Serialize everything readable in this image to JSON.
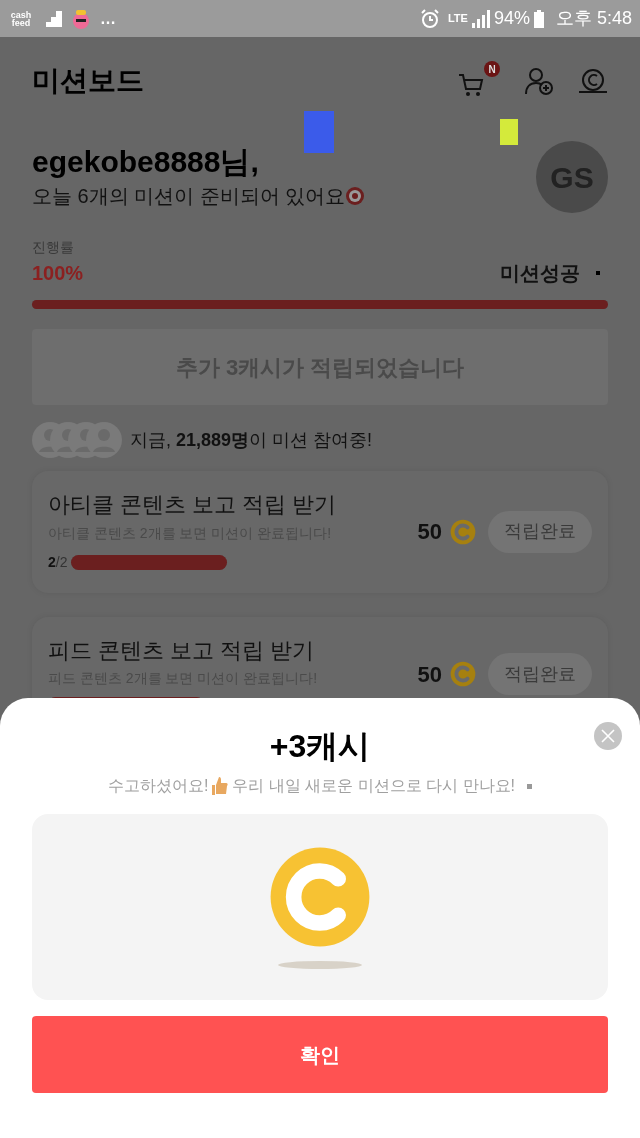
{
  "status_bar": {
    "logo": "cash feed",
    "more": "…",
    "network": "LTE",
    "battery": "94%",
    "time": "오후 5:48"
  },
  "header": {
    "title": "미션보드",
    "cart_badge": "N",
    "avatar": "GS"
  },
  "greeting": {
    "name": "egekobe8888님,",
    "message": "오늘 6개의 미션이 준비되어 있어요"
  },
  "progress": {
    "label": "진행률",
    "value": "100%",
    "status": "미션성공",
    "level": 1
  },
  "banner": "추가 3캐시가 적립되었습니다",
  "participants": "지금, **21,889명**이 미션 참여중!",
  "missions": [
    {
      "title": "아티클 콘텐츠 보고 적립 받기",
      "description": "아티클 콘텐츠 2개를 보면 미션이 완료됩니다!",
      "done": "2",
      "total": "/2",
      "level": 1,
      "reward": "50",
      "button": "적립완료",
      "disabled": true
    },
    {
      "title": "피드 콘텐츠 보고 적립 받기",
      "description": "피드 콘텐츠 2개를 보면 미션이 완료됩니다!",
      "level": 1,
      "reward": "50",
      "button": "적립완료",
      "disabled": true
    }
  ],
  "modal": {
    "title": "+3캐시",
    "message_start": "수고하셨어요!",
    "message_end": "우리 내일 새로운 미션으로 다시 만나요!",
    "confirm": "확인"
  }
}
